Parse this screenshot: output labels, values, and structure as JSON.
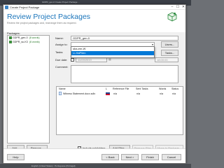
{
  "window": {
    "title": "Create Project Package",
    "minimize": "–",
    "maximize": "☐",
    "close": "✕"
  },
  "header": {
    "title": "Review Project Packages",
    "subtitle": "Review the project packages and, rearrange them as required."
  },
  "packages": {
    "label": "Packages:",
    "items": [
      {
        "name": "GDPR_gen-0",
        "tag": "(8 words)"
      },
      {
        "name": "GDPR_su-K3",
        "tag": "(8 words)"
      }
    ]
  },
  "form": {
    "name_label": "Name:",
    "name_value": "GDPR_gen-0",
    "assign_label": "Assign to:",
    "assign_value": "",
    "users_button": "Users...",
    "tasks_label": "Tasks:",
    "tasks_button": "Tasks...",
    "due_label": "Due date:",
    "due_date": "11/09/2019",
    "due_time": "18:00:00",
    "comment_label": "Comment:"
  },
  "assign_dropdown": {
    "options": [
      "sba-em-W",
      "Li-HaPilen"
    ],
    "selected_index": 1
  },
  "files_table": {
    "columns": [
      "Name",
      "L",
      "Reference File",
      "Sent Tasks",
      "Words",
      "Status"
    ],
    "rows": [
      {
        "name": "Witness Statement.docx.sdlx",
        "reference": "n/a",
        "sent_tasks": "n/a",
        "words": "n/a",
        "status": "n/a"
      }
    ]
  },
  "bottom_controls": {
    "add": "Add...",
    "remove": "Remove...",
    "include_subfolders": "Include subfolders",
    "include_checked": true,
    "add_files": "Add Files...",
    "remove_files": "Remove Files",
    "move_to_package": "Move to Package..."
  },
  "footer": {
    "help": "Help",
    "back": "< Back",
    "next": "Next >",
    "finish": "Finish",
    "cancel": "Cancel"
  },
  "background": {
    "top_text": "GDPR_gen-0  Create Project Package  ...",
    "bottom_text": "English (United States) : Portuguese (Portugal)"
  }
}
